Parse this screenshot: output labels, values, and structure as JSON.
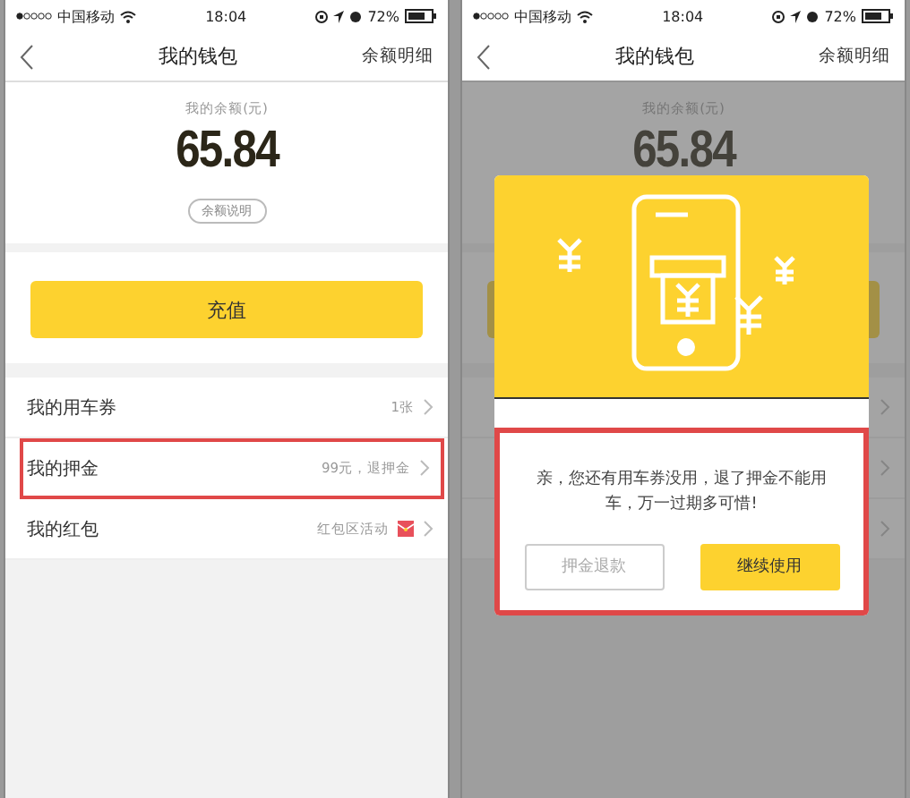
{
  "screens": [
    {
      "status_bar": {
        "carrier": "中国移动",
        "time": "18:04",
        "battery": "72%"
      },
      "nav": {
        "title": "我的钱包",
        "action": "余额明细"
      },
      "balance": {
        "label": "我的余额(元)",
        "amount": "65.84",
        "help": "余额说明"
      },
      "recharge": {
        "label": "充值"
      },
      "rows": [
        {
          "title": "我的用车券",
          "detail": "1张",
          "tag": false,
          "highlighted": false
        },
        {
          "title": "我的押金",
          "detail": "99元，退押金",
          "tag": false,
          "highlighted": true
        },
        {
          "title": "我的红包",
          "detail": "红包区活动",
          "tag": true,
          "highlighted": false
        }
      ]
    },
    {
      "status_bar": {
        "carrier": "中国移动",
        "time": "18:04",
        "battery": "72%"
      },
      "nav": {
        "title": "我的钱包",
        "action": "余额明细"
      },
      "balance": {
        "label": "我的余额(元)",
        "amount": "65.84"
      },
      "rows": [
        {
          "highlighted": false
        },
        {
          "highlighted": false
        },
        {
          "highlighted": false
        }
      ],
      "dialog": {
        "message": "亲，您还有用车券没用，退了押金不能用车，万一过期多可惜!",
        "buttons": [
          {
            "label": "押金退款",
            "kind": "secondary"
          },
          {
            "label": "继续使用",
            "kind": "primary"
          }
        ],
        "highlighted": true
      }
    }
  ]
}
